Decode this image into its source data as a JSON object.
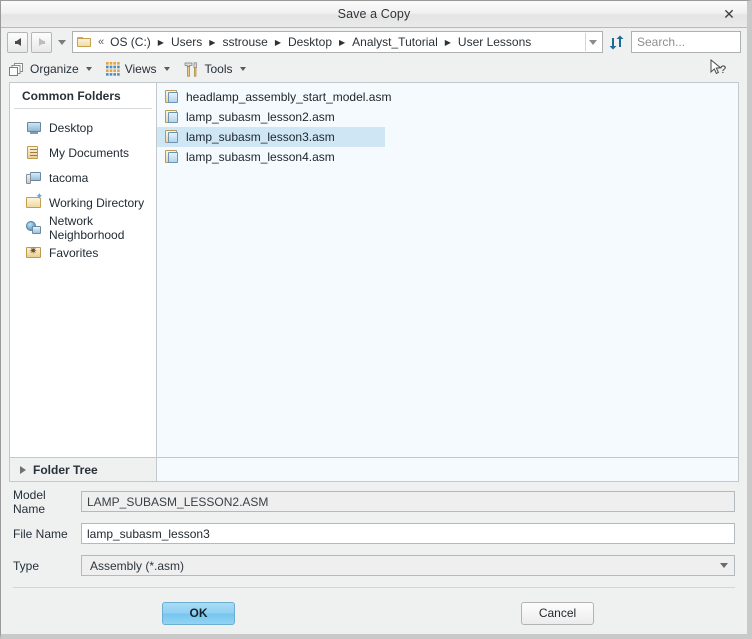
{
  "window": {
    "title": "Save a Copy",
    "close_label": "✕"
  },
  "address": {
    "back_icon": "back-arrow-icon",
    "forward_icon": "forward-arrow-icon",
    "history_caret_icon": "chevron-down-icon",
    "folder_icon": "folder-icon",
    "overflow_chevron": "«",
    "crumbs": [
      "OS (C:)",
      "Users",
      "sstrouse",
      "Desktop",
      "Analyst_Tutorial",
      "User Lessons"
    ],
    "path_caret_icon": "chevron-down-icon",
    "refresh_icon": "refresh-icon",
    "search_placeholder": "Search..."
  },
  "toolbar": {
    "organize_label": "Organize",
    "views_label": "Views",
    "tools_label": "Tools",
    "help_cursor_icon": "help-pointer-icon"
  },
  "sidebar": {
    "header": "Common Folders",
    "items": [
      {
        "label": "Desktop",
        "icon": "desktop-icon"
      },
      {
        "label": "My Documents",
        "icon": "documents-icon"
      },
      {
        "label": "tacoma",
        "icon": "computer-icon"
      },
      {
        "label": "Working Directory",
        "icon": "working-directory-icon"
      },
      {
        "label": "Network Neighborhood",
        "icon": "network-icon"
      },
      {
        "label": "Favorites",
        "icon": "favorites-icon"
      }
    ]
  },
  "filelist": {
    "files": [
      {
        "name": "headlamp_assembly_start_model.asm",
        "selected": false
      },
      {
        "name": "lamp_subasm_lesson2.asm",
        "selected": false
      },
      {
        "name": "lamp_subasm_lesson3.asm",
        "selected": true
      },
      {
        "name": "lamp_subasm_lesson4.asm",
        "selected": false
      }
    ]
  },
  "folder_tree": {
    "label": "Folder Tree",
    "expander_icon": "triangle-right-icon"
  },
  "form": {
    "model_name_label": "Model Name",
    "model_name_value": "LAMP_SUBASM_LESSON2.ASM",
    "file_name_label": "File Name",
    "file_name_value": "lamp_subasm_lesson3",
    "type_label": "Type",
    "type_value": "Assembly (*.asm)"
  },
  "buttons": {
    "ok_label": "OK",
    "cancel_label": "Cancel"
  },
  "colors": {
    "selection_blue": "#cfe7f5",
    "ok_button_blue": "#8fd0f2",
    "panel_background": "#eff0f0",
    "filelist_background": "#f4fafd"
  }
}
